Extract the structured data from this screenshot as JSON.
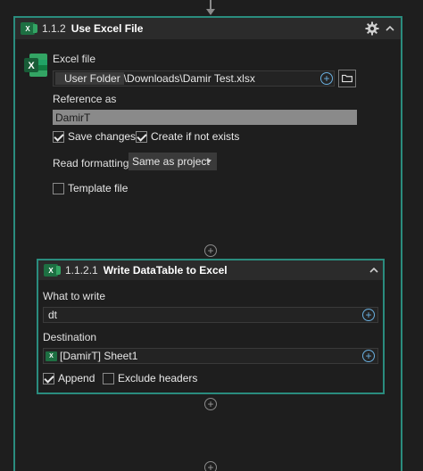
{
  "activity": {
    "number": "1.1.2",
    "title": "Use Excel File",
    "excel_file_label": "Excel file",
    "folder_chip": "User Folder",
    "file_path": "\\Downloads\\Damir Test.xlsx",
    "reference_label": "Reference as",
    "reference_value": "DamirT",
    "save_changes": "Save changes",
    "create_if_not_exists": "Create if not exists",
    "read_formatting_label": "Read formatting",
    "read_formatting_value": "Same as project",
    "template_file": "Template file"
  },
  "inner_activity": {
    "number": "1.1.2.1",
    "title": "Write DataTable to Excel",
    "what_to_write_label": "What to write",
    "what_to_write_value": "dt",
    "destination_label": "Destination",
    "destination_value": "[DamirT] Sheet1",
    "append": "Append",
    "exclude_headers": "Exclude headers"
  },
  "icons": {
    "excel": "X",
    "plus": "+",
    "settings": "gear-icon",
    "collapse": "chevron-up-icon",
    "browse": "folder-icon"
  },
  "colors": {
    "accent_border": "#2a8c7e",
    "background": "#1e1e1e",
    "excel_green": "#1d6f42",
    "plus_blue": "#6ab0e0"
  }
}
